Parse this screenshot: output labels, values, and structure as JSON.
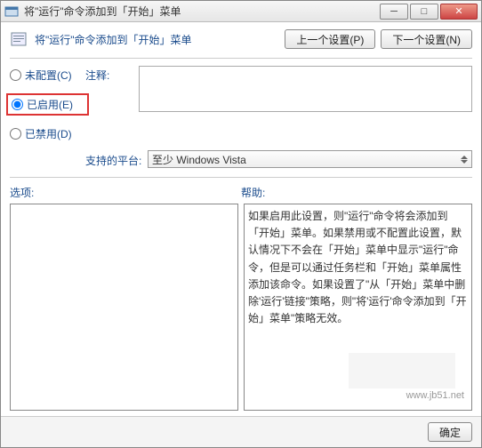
{
  "window": {
    "title": "将\"运行\"命令添加到「开始」菜单",
    "min": "─",
    "max": "□",
    "close": "✕"
  },
  "header": {
    "text": "将\"运行\"命令添加到「开始」菜单",
    "prev_btn": "上一个设置(P)",
    "next_btn": "下一个设置(N)"
  },
  "radios": {
    "not_configured": "未配置(C)",
    "enabled": "已启用(E)",
    "disabled": "已禁用(D)"
  },
  "labels": {
    "comment": "注释:",
    "platforms": "支持的平台:",
    "options": "选项:",
    "help": "帮助:"
  },
  "platform_value": "至少 Windows Vista",
  "help_text": "如果启用此设置，则\"运行\"命令将会添加到「开始」菜单。如果禁用或不配置此设置，默认情况下不会在「开始」菜单中显示\"运行\"命令，但是可以通过任务栏和「开始」菜单属性添加该命令。如果设置了\"从「开始」菜单中删除'运行'链接\"策略，则\"将'运行'命令添加到「开始」菜单\"策略无效。",
  "footer": {
    "ok": "确定"
  },
  "watermark": "www.jb51.net"
}
